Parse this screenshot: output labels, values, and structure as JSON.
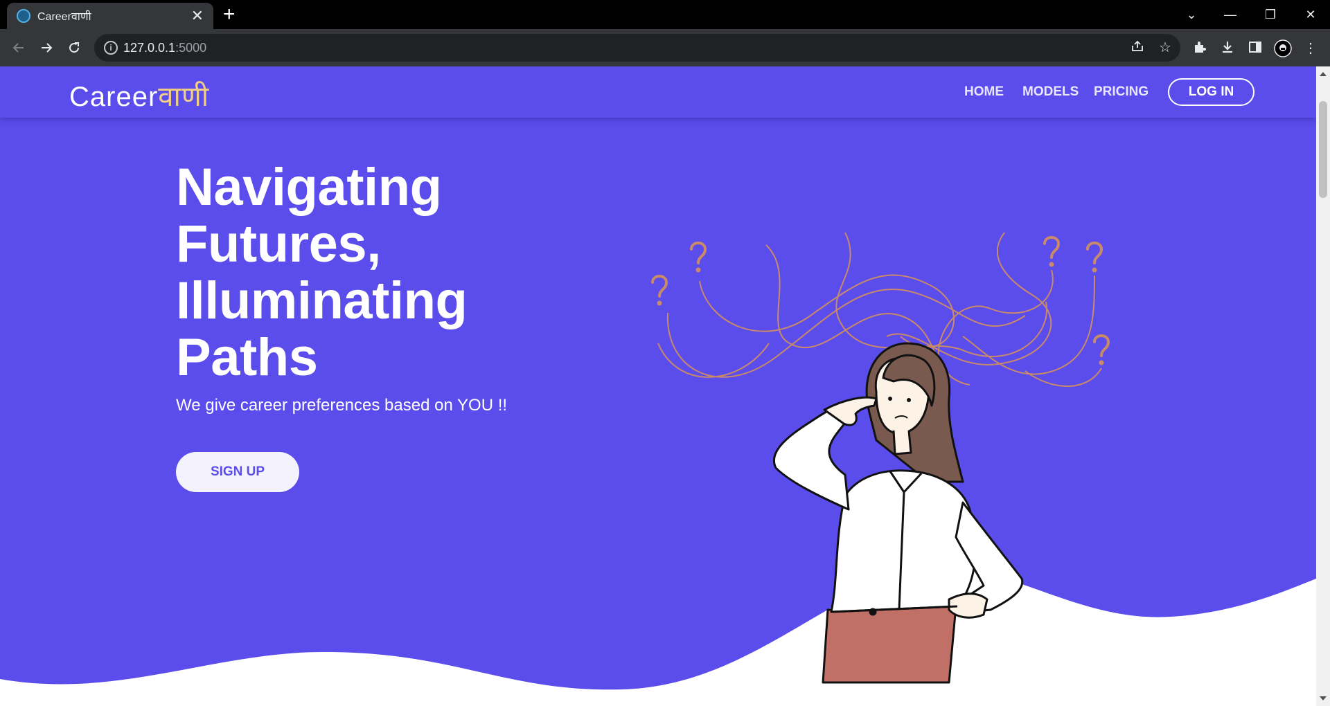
{
  "browser": {
    "tab_title": "Careerवाणी",
    "tab_close": "✕",
    "new_tab": "+",
    "url_host": "127.0.0.1",
    "url_port": ":5000",
    "window_controls": {
      "minimize": "—",
      "restore": "❐",
      "close": "✕",
      "tab_search": "⌄"
    },
    "icons": [
      "back-icon",
      "forward-icon",
      "reload-icon",
      "info-icon",
      "share-icon",
      "star-icon",
      "extensions-icon",
      "download-icon",
      "side-panel-icon",
      "profile-icon",
      "menu-icon"
    ]
  },
  "site": {
    "logo_main": "Career",
    "logo_accent": "वाणी",
    "nav": [
      "HOME",
      "MODELS",
      "PRICING"
    ],
    "login_label": "LOG IN",
    "hero_lines": [
      "Navigating",
      "Futures,",
      "Illuminating",
      "Paths"
    ],
    "hero_subtitle": "We give career preferences based on YOU !!",
    "signup_label": "SIGN UP",
    "illustration": "thinking-woman-with-question-marks",
    "colors": {
      "background": "#5b4deb",
      "accent_logo": "#f3cf86",
      "question_marks": "#c98a6a",
      "wave": "#ffffff"
    }
  }
}
